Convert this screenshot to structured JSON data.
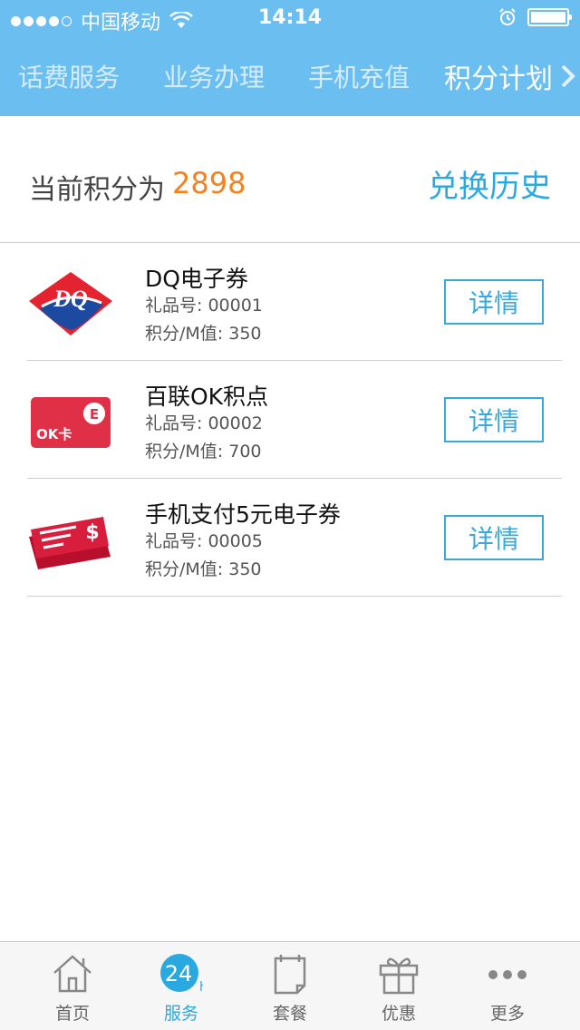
{
  "status_bar": {
    "carrier": "中国移动",
    "time": "14:14",
    "signal_filled": 4,
    "signal_total": 5,
    "battery_level": 0.9
  },
  "top_tabs": [
    {
      "label": "话费服务",
      "active": false
    },
    {
      "label": "业务办理",
      "active": false
    },
    {
      "label": "手机充值",
      "active": false
    },
    {
      "label": "积分计划",
      "active": true
    }
  ],
  "points": {
    "label": "当前积分为",
    "value": "2898",
    "history_link": "兑换历史"
  },
  "gifts": [
    {
      "title": "DQ电子券",
      "gift_no": "礼品号: 00001",
      "points": "积分/M值: 350",
      "button": "详情",
      "icon": "dq-logo-icon"
    },
    {
      "title": "百联OK积点",
      "gift_no": "礼品号: 00002",
      "points": "积分/M值: 700",
      "button": "详情",
      "icon": "ok-card-icon",
      "card_text": "OK卡"
    },
    {
      "title": "手机支付5元电子券",
      "gift_no": "礼品号: 00005",
      "points": "积分/M值: 350",
      "button": "详情",
      "icon": "mobile-pay-voucher-icon"
    }
  ],
  "bottom_tabs": [
    {
      "label": "首页",
      "icon": "home-icon",
      "active": false
    },
    {
      "label": "服务",
      "icon": "service-24h-icon",
      "active": true
    },
    {
      "label": "套餐",
      "icon": "package-icon",
      "active": false
    },
    {
      "label": "优惠",
      "icon": "gift-icon",
      "active": false
    },
    {
      "label": "更多",
      "icon": "more-icon",
      "active": false
    }
  ],
  "colors": {
    "header_blue": "#6bbff0",
    "accent_blue": "#2aa9e0",
    "points_orange": "#f5821f",
    "dq_red": "#e52330",
    "dq_blue": "#1c4aa0"
  }
}
